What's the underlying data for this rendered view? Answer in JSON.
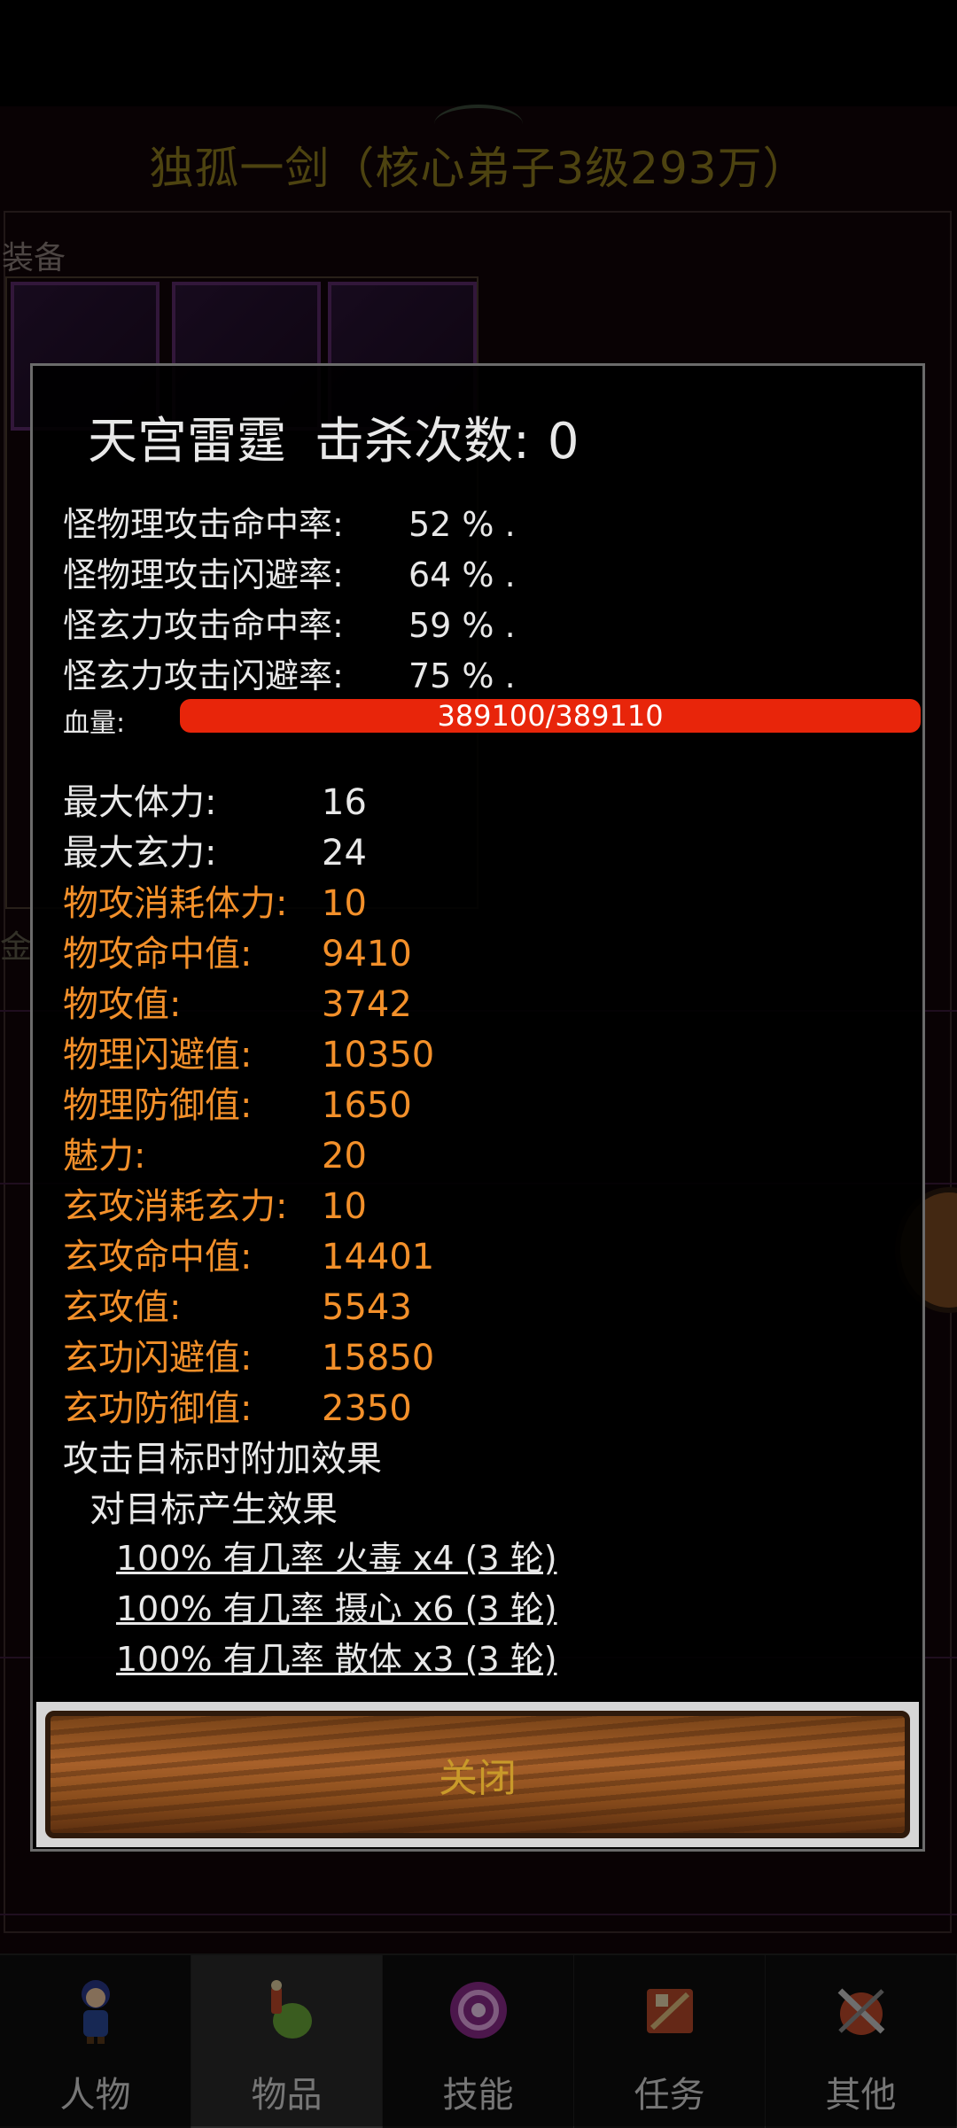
{
  "background": {
    "title": "独孤一剑（核心弟子3级293万）",
    "equip_label": "装备",
    "gold_label": "金"
  },
  "dialog": {
    "monster_name": "天宫雷霆",
    "kill_count_label": "击杀次数:",
    "kill_count": "0",
    "rates": [
      {
        "label": "怪物理攻击命中率:",
        "value": "52 % ."
      },
      {
        "label": "怪物理攻击闪避率:",
        "value": "64 % ."
      },
      {
        "label": "怪玄力攻击命中率:",
        "value": "59 % ."
      },
      {
        "label": "怪玄力攻击闪避率:",
        "value": "75 % ."
      }
    ],
    "hp": {
      "label": "血量:",
      "text": "389100/389110",
      "fraction": 0.99997
    },
    "stats": [
      {
        "label": "最大体力:",
        "value": "16"
      },
      {
        "label": "最大玄力:",
        "value": "24"
      },
      {
        "label": "物攻消耗体力:",
        "value": "10"
      },
      {
        "label": "物攻命中值:",
        "value": "9410"
      },
      {
        "label": "物攻值:",
        "value": "3742"
      },
      {
        "label": "物理闪避值:",
        "value": "10350"
      },
      {
        "label": "物理防御值:",
        "value": "1650"
      },
      {
        "label": "魅力:",
        "value": "20"
      },
      {
        "label": "玄攻消耗玄力:",
        "value": "10"
      },
      {
        "label": "玄攻命中值:",
        "value": "14401"
      },
      {
        "label": "玄攻值:",
        "value": "5543"
      },
      {
        "label": "玄功闪避值:",
        "value": "15850"
      },
      {
        "label": "玄功防御值:",
        "value": "2350"
      }
    ],
    "effect_heading": "攻击目标时附加效果",
    "effect_subheading": "对目标产生效果",
    "effects": [
      "100% 有几率 火毒 x4 (3 轮)",
      "100% 有几率 摄心 x6 (3 轮)",
      "100% 有几率 散体 x3 (3 轮)"
    ],
    "close_label": "关闭"
  },
  "nav": {
    "items": [
      {
        "label": "人物",
        "icon": "character-icon"
      },
      {
        "label": "物品",
        "icon": "items-icon"
      },
      {
        "label": "技能",
        "icon": "skills-icon"
      },
      {
        "label": "任务",
        "icon": "quests-icon"
      },
      {
        "label": "其他",
        "icon": "other-icon"
      }
    ],
    "active": "物品"
  },
  "colors": {
    "accent_orange": "#f3902a",
    "hp_red": "#e8250a",
    "title_gold": "#8c7a1e"
  }
}
